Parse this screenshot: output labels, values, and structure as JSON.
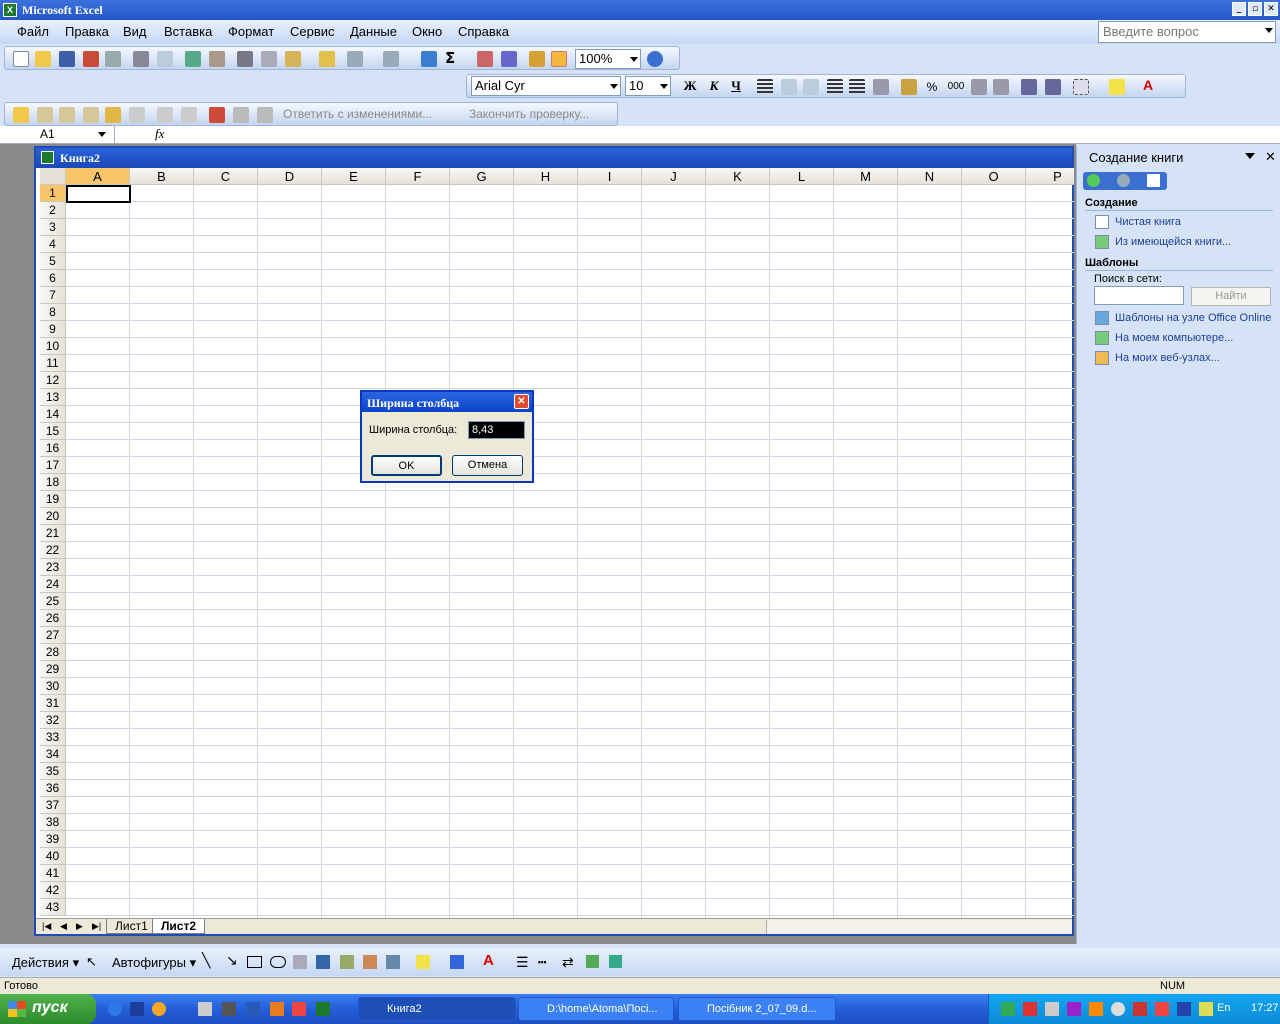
{
  "window": {
    "title": "Microsoft Excel"
  },
  "menu": [
    "Файл",
    "Правка",
    "Вид",
    "Вставка",
    "Формат",
    "Сервис",
    "Данные",
    "Окно",
    "Справка"
  ],
  "ask": {
    "placeholder": "Введите вопрос"
  },
  "standard_toolbar": {
    "zoom": "100%"
  },
  "format_toolbar": {
    "font": "Arial Cyr",
    "size": "10",
    "bold": "Ж",
    "italic": "К",
    "underline": "Ч",
    "percent": "%",
    "thousands": "000"
  },
  "review_toolbar": {
    "reply": "Ответить с изменениями...",
    "finish": "Закончить проверку..."
  },
  "formula_bar": {
    "name_box": "A1",
    "fx": "fx"
  },
  "workbook": {
    "title": "Книга2",
    "columns": [
      "A",
      "B",
      "C",
      "D",
      "E",
      "F",
      "G",
      "H",
      "I",
      "J",
      "K",
      "L",
      "M",
      "N",
      "O",
      "P"
    ],
    "rows": [
      "1",
      "2",
      "3",
      "4",
      "5",
      "6",
      "7",
      "8",
      "9",
      "10",
      "11",
      "12",
      "13",
      "14",
      "15",
      "16",
      "17",
      "18",
      "19",
      "20",
      "21",
      "22",
      "23",
      "24",
      "25",
      "26",
      "27",
      "28",
      "29",
      "30",
      "31",
      "32",
      "33",
      "34",
      "35",
      "36",
      "37",
      "38",
      "39",
      "40",
      "41",
      "42",
      "43"
    ],
    "sheets": [
      "Лист1",
      "Лист2"
    ],
    "active_sheet": "Лист2"
  },
  "task_pane": {
    "title": "Создание книги",
    "section_create": "Создание",
    "blank": "Чистая книга",
    "from_existing": "Из имеющейся книги...",
    "section_templates": "Шаблоны",
    "search_label": "Поиск в сети:",
    "find_button": "Найти",
    "links": [
      "Шаблоны на узле Office Online",
      "На моем компьютере...",
      "На моих веб-узлах..."
    ]
  },
  "dialog": {
    "title": "Ширина столбца",
    "label": "Ширина столбца:",
    "value": "8,43",
    "ok": "OK",
    "cancel": "Отмена"
  },
  "drawing_toolbar": {
    "actions": "Действия",
    "autoshapes": "Автофигуры"
  },
  "status": {
    "ready": "Готово",
    "num": "NUM"
  },
  "taskbar": {
    "start": "пуск",
    "tasks": [
      "Книга2",
      "D:\\home\\Atoma\\Посі...",
      "Посібник 2_07_09.d..."
    ],
    "lang": "En",
    "time": "17:27"
  }
}
